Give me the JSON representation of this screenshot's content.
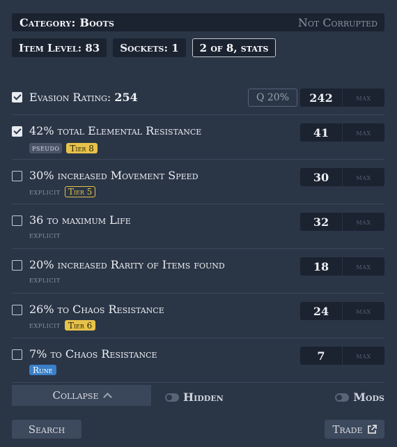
{
  "header": {
    "category": "Category: Boots",
    "corrupted": "Not Corrupted"
  },
  "chips": {
    "item_level": "Item Level: 83",
    "sockets": "Sockets:  1",
    "stats": "2 of 8, stats"
  },
  "stats": [
    {
      "checked": true,
      "label_pre": "Evasion Rating: ",
      "label_bold": "254",
      "quality": "Q 20%",
      "value": "242",
      "max": "max"
    },
    {
      "checked": true,
      "label": "42% total Elemental Resistance",
      "tag": "pseudo",
      "tier": "Tier 8",
      "tier_style": "solid",
      "value": "41",
      "max": "max"
    },
    {
      "checked": false,
      "label": "30% increased Movement Speed",
      "source": "explicit",
      "tier": "Tier 5",
      "tier_style": "outline",
      "value": "30",
      "max": "max"
    },
    {
      "checked": false,
      "label": "36 to maximum Life",
      "source": "explicit",
      "value": "32",
      "max": "max"
    },
    {
      "checked": false,
      "label": "20% increased Rarity of Items found",
      "source": "explicit",
      "value": "18",
      "max": "max"
    },
    {
      "checked": false,
      "label": "26% to Chaos Resistance",
      "source": "explicit",
      "tier": "Tier 6",
      "tier_style": "solid",
      "value": "24",
      "max": "max"
    },
    {
      "checked": false,
      "label": "7% to Chaos Resistance",
      "rune": "Rune",
      "value": "7",
      "max": "max"
    }
  ],
  "footer": {
    "collapse": "Collapse",
    "hidden": "Hidden",
    "mods": "Mods",
    "search": "Search",
    "trade": "Trade"
  },
  "colors": {
    "background": "#2a3546",
    "panel": "#1b2230",
    "tier": "#e7c24a",
    "rune": "#3a7fc7"
  }
}
